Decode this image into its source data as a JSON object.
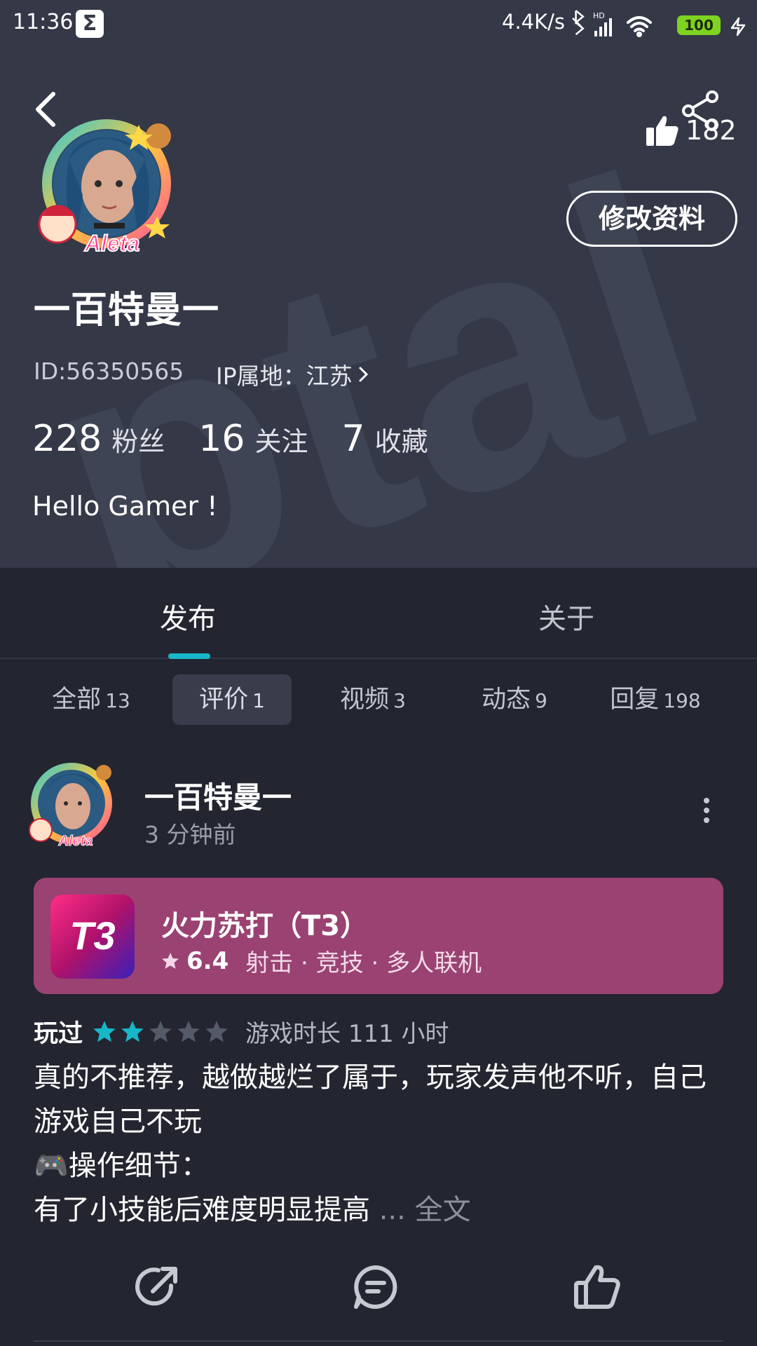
{
  "status_bar": {
    "time": "11:36",
    "sigma_icon": "Σ",
    "net_speed": "4.4K/s",
    "battery": "100"
  },
  "profile": {
    "nickname": "一百特曼一",
    "id_text": "ID:56350565",
    "ip_text": "IP属地：江苏",
    "likes": "182",
    "edit_button": "修改资料",
    "stats": [
      {
        "num": "228",
        "label": "粉丝"
      },
      {
        "num": "16",
        "label": "关注"
      },
      {
        "num": "7",
        "label": "收藏"
      }
    ],
    "bio": "Hello Gamer !"
  },
  "tabs": {
    "publish": "发布",
    "about": "关于"
  },
  "filters": [
    {
      "label": "全部",
      "count": "13"
    },
    {
      "label": "评价",
      "count": "1"
    },
    {
      "label": "视频",
      "count": "3"
    },
    {
      "label": "动态",
      "count": "9"
    },
    {
      "label": "回复",
      "count": "198"
    }
  ],
  "post": {
    "author": "一百特曼一",
    "time": "3 分钟前",
    "game": {
      "name": "火力苏打（T3）",
      "icon_text": "T3",
      "score": "6.4",
      "tags": "射击 · 竞技 · 多人联机"
    },
    "played_label": "玩过",
    "rating_stars": 2,
    "playtime": "游戏时长 111 小时",
    "review_line1": "真的不推荐，越做越烂了属于，玩家发声他不听，自己游戏自己不玩",
    "review_line2": "🎮操作细节：",
    "review_line3": "有了小技能后难度明显提高",
    "ellipsis": " ... ",
    "full_text": "全文"
  },
  "colors": {
    "header_bg": "#343847",
    "page_bg": "#232530",
    "accent": "#17b7c8",
    "game_card": "#9a4272"
  },
  "icons": [
    "back-icon",
    "share-icon",
    "thumbs-up-icon",
    "chevron-right-icon",
    "more-vertical-icon",
    "star-icon",
    "share-arrow-icon",
    "comment-icon",
    "like-icon"
  ]
}
